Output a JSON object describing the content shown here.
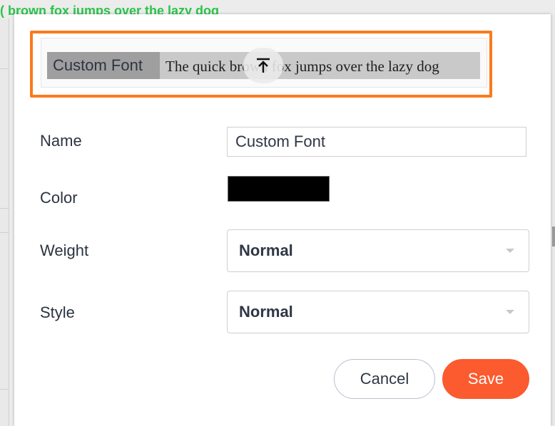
{
  "background": {
    "partial_text": "( brown fox jumps over the lazy dog"
  },
  "preview": {
    "font_chip": "Custom Font",
    "sample_text": "The quick brown fox jumps over the lazy dog",
    "upload_icon": "upload-arrow-icon"
  },
  "form": {
    "name_label": "Name",
    "name_value": "Custom Font",
    "color_label": "Color",
    "color_value": "#000000",
    "weight_label": "Weight",
    "weight_value": "Normal",
    "style_label": "Style",
    "style_value": "Normal"
  },
  "actions": {
    "cancel_label": "Cancel",
    "save_label": "Save"
  },
  "colors": {
    "accent_highlight": "#fb7a1c",
    "save_button": "#fb5b2e",
    "background_text": "#2bc44a"
  }
}
